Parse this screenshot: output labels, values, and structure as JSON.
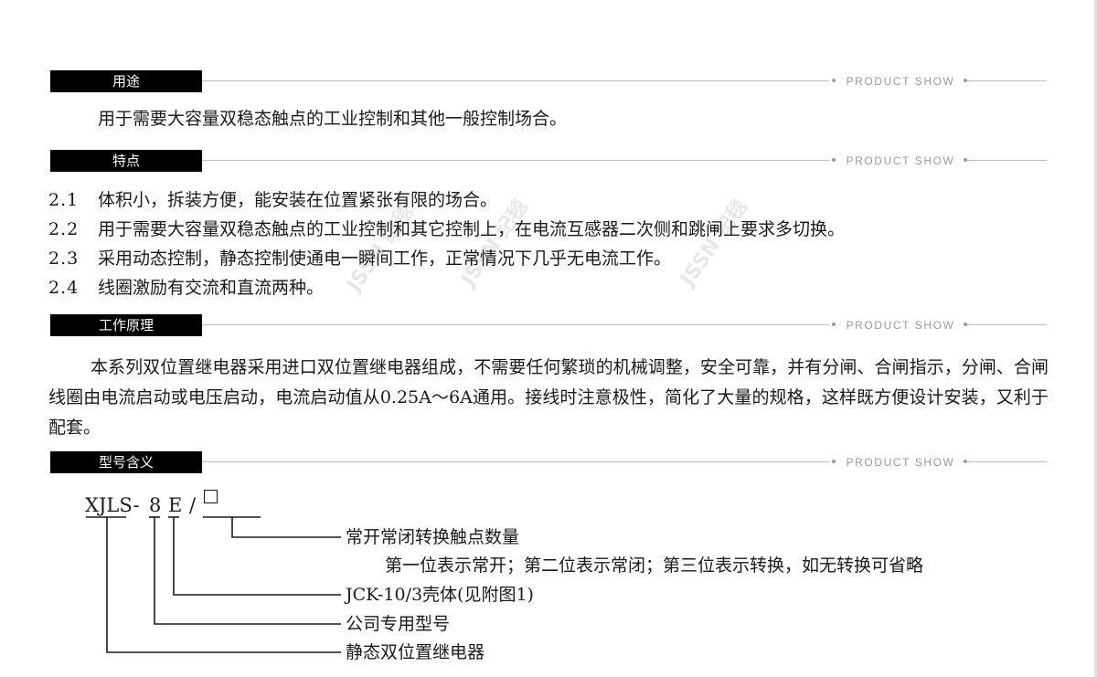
{
  "sections": {
    "usage": {
      "title": "用途",
      "watermark": "PRODUCT SHOW",
      "text": "用于需要大容量双稳态触点的工业控制和其他一般控制场合。"
    },
    "features": {
      "title": "特点",
      "watermark": "PRODUCT SHOW",
      "items": [
        {
          "num": "2.1",
          "text": "体积小，拆装方便，能安装在位置紧张有限的场合。"
        },
        {
          "num": "2.2",
          "text": "用于需要大容量双稳态触点的工业控制和其它控制上，在电流互感器二次侧和跳闸上要求多切换。"
        },
        {
          "num": "2.3",
          "text": "采用动态控制，静态控制使通电一瞬间工作，正常情况下几乎无电流工作。"
        },
        {
          "num": "2.4",
          "text": "线圈激励有交流和直流两种。"
        }
      ]
    },
    "principle": {
      "title": "工作原理",
      "watermark": "PRODUCT SHOW",
      "text": "本系列双位置继电器采用进口双位置继电器组成，不需要任何繁琐的机械调整，安全可靠，并有分闸、合闸指示，分闸、合闸线圈由电流启动或电压启动，电流启动值从0.25A～6A通用。接线时注意极性，简化了大量的规格，这样既方便设计安装，又利于配套。"
    },
    "model": {
      "title": "型号含义",
      "watermark": "PRODUCT SHOW",
      "code": {
        "prefix": "XJLS-",
        "digit": "8",
        "letter": "E",
        "slash": "/"
      },
      "labels": {
        "contacts": "常开常闭转换触点数量",
        "contacts_note": "第一位表示常开；第二位表示常闭；第三位表示转换，如无转换可省略",
        "housing": "JCK-10/3壳体(见附图1)",
        "company": "公司专用型号",
        "product": "静态双位置继电器"
      }
    }
  },
  "watermarks": [
    "JSSN 纪毯",
    "JSSN 纪毯",
    "JSSN 纪毯"
  ],
  "colors": {
    "tab_background": "#000000",
    "tab_text": "#ffffff",
    "body_text": "#1a1a1a",
    "rule": "#bdbdbd"
  }
}
